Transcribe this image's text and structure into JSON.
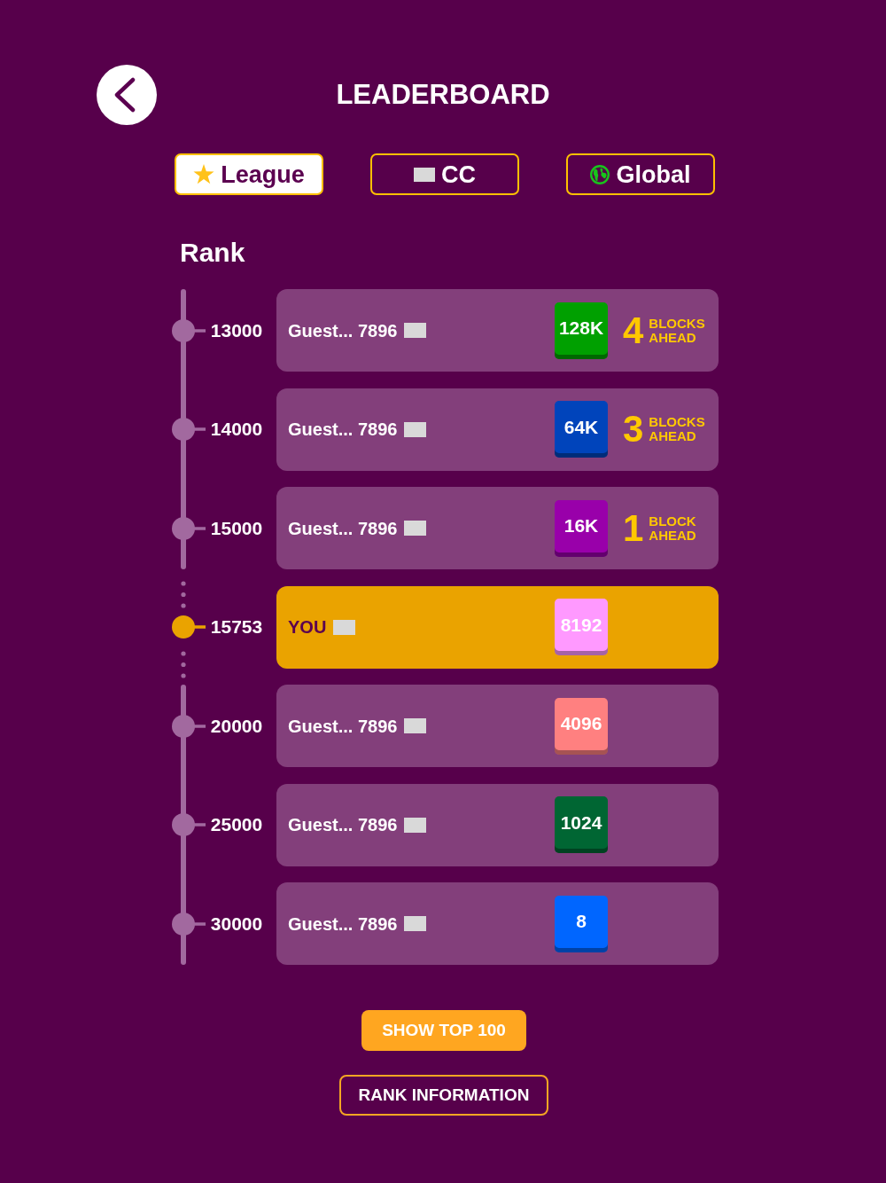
{
  "header": {
    "title": "LEADERBOARD"
  },
  "tabs": [
    {
      "label": "League",
      "kind": "star",
      "selected": true
    },
    {
      "label": "CC",
      "kind": "flag",
      "selected": false
    },
    {
      "label": "Global",
      "kind": "globe",
      "selected": false
    }
  ],
  "rank_heading": "Rank",
  "rows": [
    {
      "rank": "13000",
      "name": "Guest... 7896",
      "tile": "128K",
      "color": "#00a000",
      "ahead_count": "4",
      "ahead_label": "BLOCKS AHEAD",
      "highlighted": false
    },
    {
      "rank": "14000",
      "name": "Guest... 7896",
      "tile": "64K",
      "color": "#0044bb",
      "ahead_count": "3",
      "ahead_label": "BLOCKS AHEAD",
      "highlighted": false
    },
    {
      "rank": "15000",
      "name": "Guest... 7896",
      "tile": "16K",
      "color": "#9900aa",
      "ahead_count": "1",
      "ahead_label": "BLOCK AHEAD",
      "highlighted": false
    },
    {
      "rank": "15753",
      "name": "YOU",
      "tile": "8192",
      "color": "#ff99ff",
      "highlighted": true
    },
    {
      "rank": "20000",
      "name": "Guest... 7896",
      "tile": "4096",
      "color": "#ff8080",
      "highlighted": false
    },
    {
      "rank": "25000",
      "name": "Guest... 7896",
      "tile": "1024",
      "color": "#006633",
      "highlighted": false
    },
    {
      "rank": "30000",
      "name": "Guest... 7896",
      "tile": "8",
      "color": "#0066ff",
      "highlighted": false
    }
  ],
  "buttons": [
    {
      "label": "SHOW TOP 100",
      "kind": "filled"
    },
    {
      "label": "RANK INFORMATION",
      "kind": "outline"
    }
  ]
}
